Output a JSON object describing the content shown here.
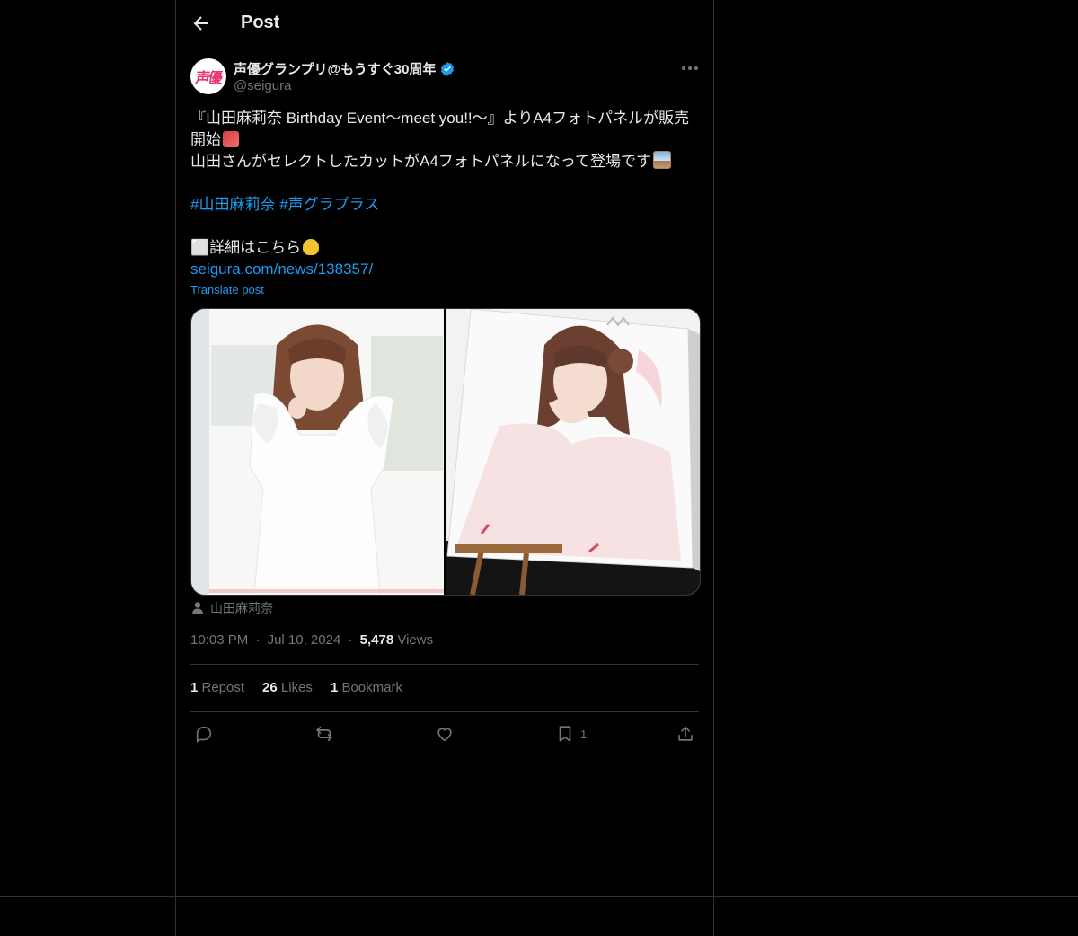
{
  "header": {
    "title": "Post"
  },
  "author": {
    "display_name": "声優グランプリ@もうすぐ30周年",
    "handle": "@seigura",
    "avatar_text": "声優"
  },
  "post": {
    "line1": "『山田麻莉奈 Birthday Event〜meet you!!〜』よりA4フォトパネルが販売",
    "line2": "開始",
    "line3": "山田さんがセレクトしたカットがA4フォトパネルになって登場です",
    "hashtag1": "#山田麻莉奈",
    "hashtag2": "#声グラプラス",
    "details": "⬜詳細はこちら",
    "url": "seigura.com/news/138357/",
    "translate": "Translate post"
  },
  "media_tag": "山田麻莉奈",
  "meta": {
    "time": "10:03 PM",
    "sep": "·",
    "date": "Jul 10, 2024",
    "views_count": "5,478",
    "views_label": "Views"
  },
  "stats": {
    "reposts_count": "1",
    "reposts_label": "Repost",
    "likes_count": "26",
    "likes_label": "Likes",
    "bookmarks_count": "1",
    "bookmarks_label": "Bookmark"
  },
  "actions": {
    "bookmark_count": "1"
  },
  "colors": {
    "background": "#000000",
    "text": "#e7e9ea",
    "muted": "#71767b",
    "link": "#1d9bf0",
    "border": "#2f3336",
    "verified": "#1d9bf0"
  },
  "icons": [
    "back-arrow-icon",
    "verified-badge-icon",
    "more-icon",
    "person-icon",
    "reply-icon",
    "repost-icon",
    "like-icon",
    "bookmark-icon",
    "share-icon"
  ]
}
